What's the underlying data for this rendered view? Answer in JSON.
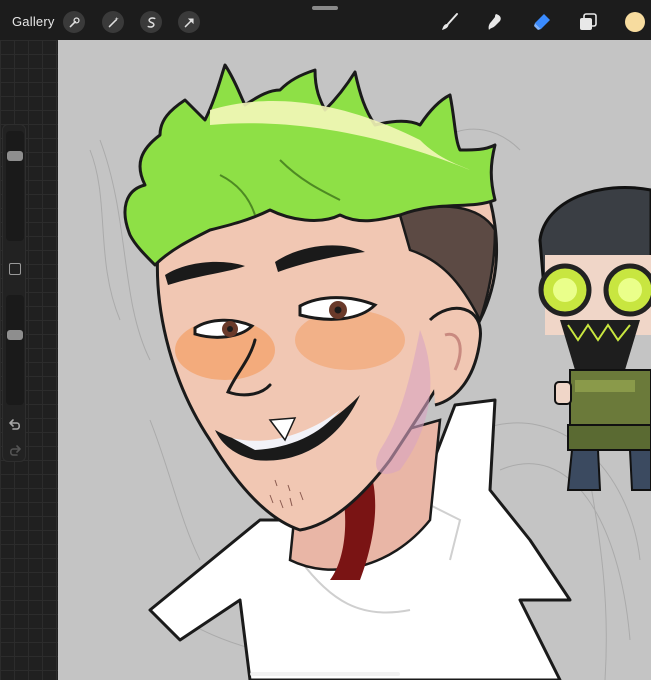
{
  "toolbar": {
    "gallery_label": "Gallery",
    "left_tools": [
      "wrench-icon",
      "magic-wand-icon",
      "selection-s-icon",
      "transform-arrow-icon"
    ],
    "right_tools": [
      "brush-icon",
      "smudge-icon",
      "eraser-icon",
      "layers-icon"
    ],
    "active_tool": "eraser-icon",
    "accent_color": "#3a8bff",
    "current_color": "#f7dc9f"
  },
  "sidebar": {
    "size_slider_level": 0.2,
    "opacity_slider_level": 0.35
  },
  "canvas": {
    "background_color": "#c4c4c4"
  }
}
